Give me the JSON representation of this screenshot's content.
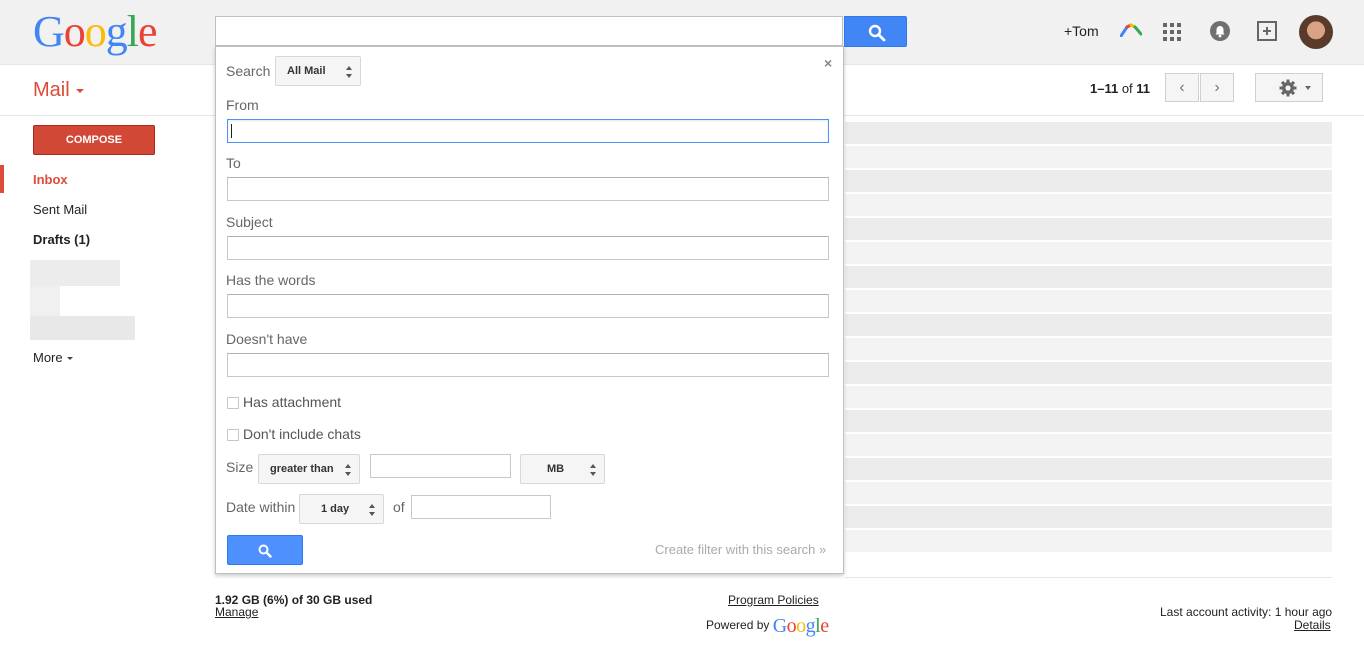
{
  "header": {
    "logo_letters": [
      {
        "ch": "G",
        "color": "#4285f4"
      },
      {
        "ch": "o",
        "color": "#ea4335"
      },
      {
        "ch": "o",
        "color": "#fbbc05"
      },
      {
        "ch": "g",
        "color": "#4285f4"
      },
      {
        "ch": "l",
        "color": "#34a853"
      },
      {
        "ch": "e",
        "color": "#ea4335"
      }
    ],
    "search_value": "",
    "plus_user": "+Tom",
    "icons": [
      "search-icon",
      "hangouts-icon",
      "apps-grid-icon",
      "notifications-bell-icon",
      "share-plus-icon",
      "avatar"
    ]
  },
  "subbar": {
    "app_label": "Mail",
    "pager_range": "1–11",
    "pager_of": "of",
    "pager_total": "11"
  },
  "sidebar": {
    "compose_label": "COMPOSE",
    "items": [
      {
        "label": "Inbox",
        "active": true
      },
      {
        "label": "Sent Mail",
        "active": false
      },
      {
        "label": "Drafts (1)",
        "active": false
      }
    ],
    "more_label": "More"
  },
  "advanced_search": {
    "search_label": "Search",
    "scope_value": "All Mail",
    "from_label": "From",
    "to_label": "To",
    "subject_label": "Subject",
    "has_words_label": "Has the words",
    "doesnt_have_label": "Doesn't have",
    "has_attachment_label": "Has attachment",
    "no_chats_label": "Don't include chats",
    "size_label": "Size",
    "size_op_value": "greater than",
    "size_unit_value": "MB",
    "date_within_label": "Date within",
    "date_within_value": "1 day",
    "of_label": "of",
    "create_filter_label": "Create filter with this search »",
    "close_label": "×"
  },
  "footer": {
    "storage": "1.92 GB (6%) of 30 GB used",
    "manage": "Manage",
    "program_policies": "Program Policies",
    "powered_by": "Powered by",
    "powered_brand": "Google",
    "last_activity": "Last account activity: 1 hour ago",
    "details": "Details"
  },
  "colors": {
    "accent_red": "#dd4b39",
    "compose_red": "#d14836",
    "search_blue": "#4285f4"
  }
}
